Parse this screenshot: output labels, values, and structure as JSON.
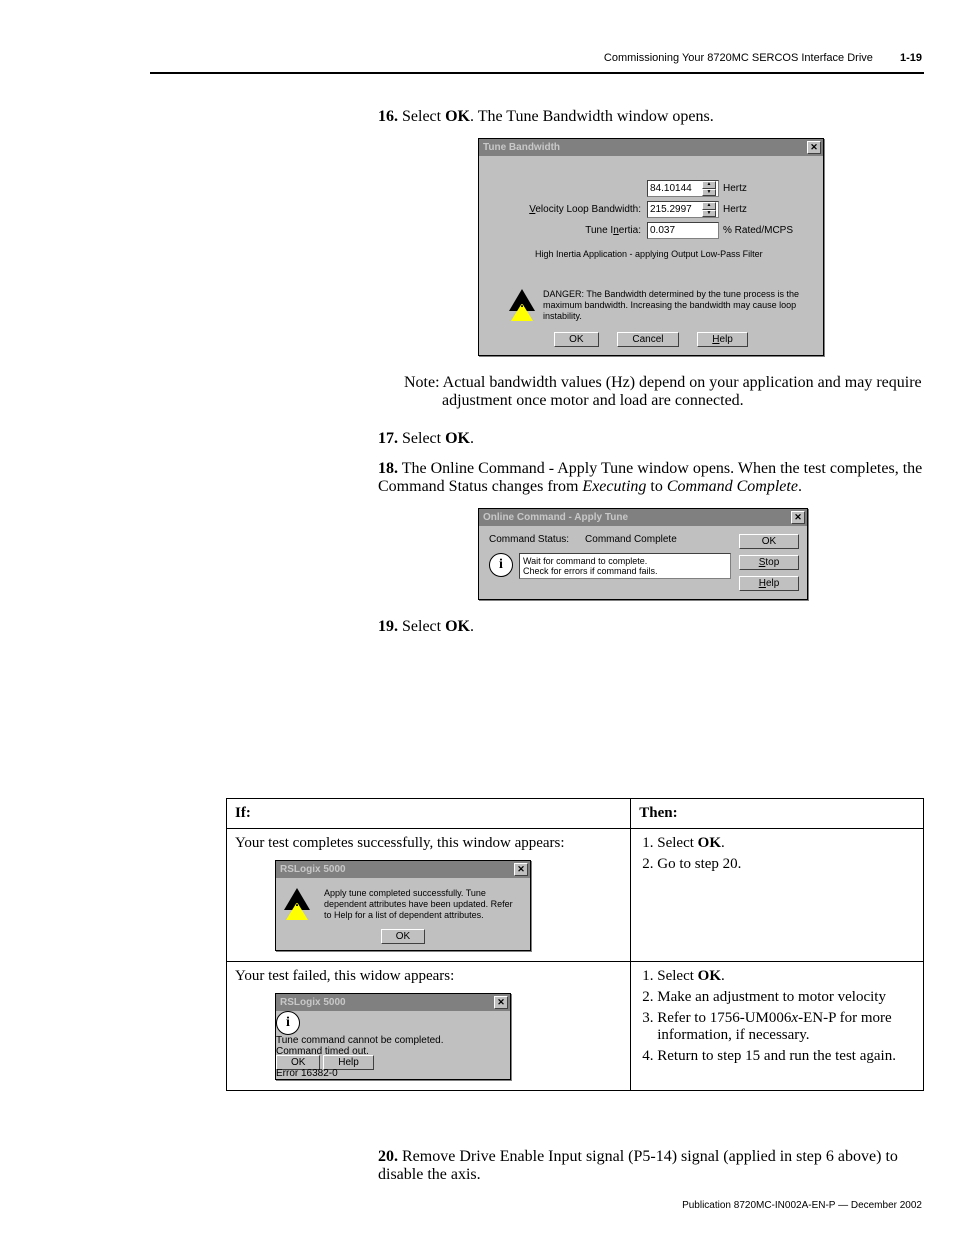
{
  "header": {
    "title": "Commissioning Your 8720MC SERCOS Interface Drive",
    "page": "1-19"
  },
  "steps": {
    "s16_num": "16.",
    "s16": "Select OK. The Tune Bandwidth window opens.",
    "s16_a": "Select ",
    "s16_b": "OK",
    "s16_c": ". The Tune Bandwidth window opens.",
    "note": "Note: Actual bandwidth values (Hz) depend on your application and may require adjustment once motor and load are connected.",
    "s17_num": "17.",
    "s17_a": "Select ",
    "s17_b": "OK",
    "s17_c": ".",
    "s18_num": "18.",
    "s18_a": "The Online Command - Apply Tune window opens. When the test completes, the Command Status changes from ",
    "s18_i1": "Executing",
    "s18_mid": " to ",
    "s18_i2": "Command Complete",
    "s18_end": ".",
    "s19_num": "19.",
    "s19_a": "Select ",
    "s19_b": "OK",
    "s19_c": ".",
    "s20_num": "20.",
    "s20": "Remove Drive Enable Input signal (P5-14) signal (applied in step 6 above) to disable the axis."
  },
  "tune_dialog": {
    "title": "Tune Bandwidth",
    "row1_value": "84.10144",
    "row1_unit": "Hertz",
    "row2_label": "Velocity Loop Bandwidth:",
    "row2_value": "215.2997",
    "row2_unit": "Hertz",
    "row3_label": "Tune Inertia:",
    "row3_value": "0.037",
    "row3_unit": "% Rated/MCPS",
    "msg": "High Inertia Application - applying Output Low-Pass Filter",
    "danger": "DANGER: The Bandwidth determined by the tune process is the maximum bandwidth. Increasing the bandwidth may cause loop instability.",
    "btn_ok": "OK",
    "btn_cancel": "Cancel",
    "btn_help": "Help"
  },
  "online_dialog": {
    "title": "Online Command - Apply Tune",
    "status_label": "Command Status:",
    "status_value": "Command Complete",
    "info_l1": "Wait for command to complete.",
    "info_l2": "Check for errors if command fails.",
    "btn_ok": "OK",
    "btn_stop": "Stop",
    "btn_help": "Help"
  },
  "table": {
    "h_if": "If:",
    "h_then": "Then:",
    "r1_if": "Your test completes successfully, this window appears:",
    "r1_then_1a": "Select ",
    "r1_then_1b": "OK",
    "r1_then_1c": ".",
    "r1_then_2": "Go to step 20.",
    "r2_if": "Your test failed, this widow appears:",
    "r2_then_1a": "Select ",
    "r2_then_1b": "OK",
    "r2_then_1c": ".",
    "r2_then_2": "Make an adjustment to motor velocity",
    "r2_then_3a": "Refer to 1756-UM006",
    "r2_then_3i": "x",
    "r2_then_3b": "-EN-P for more information, if necessary.",
    "r2_then_4": "Return to step 15 and run the test again."
  },
  "rsl_success": {
    "title": "RSLogix 5000",
    "msg": "Apply tune completed successfully. Tune dependent attributes have been updated. Refer to Help for a list of dependent attributes.",
    "btn_ok": "OK"
  },
  "rsl_fail": {
    "title": "RSLogix 5000",
    "msg_l1": "Tune command cannot be completed.",
    "msg_l2": "Command timed out.",
    "btn_ok": "OK",
    "btn_help": "Help",
    "error": "Error 16382-0"
  },
  "footer": "Publication 8720MC-IN002A-EN-P — December 2002"
}
